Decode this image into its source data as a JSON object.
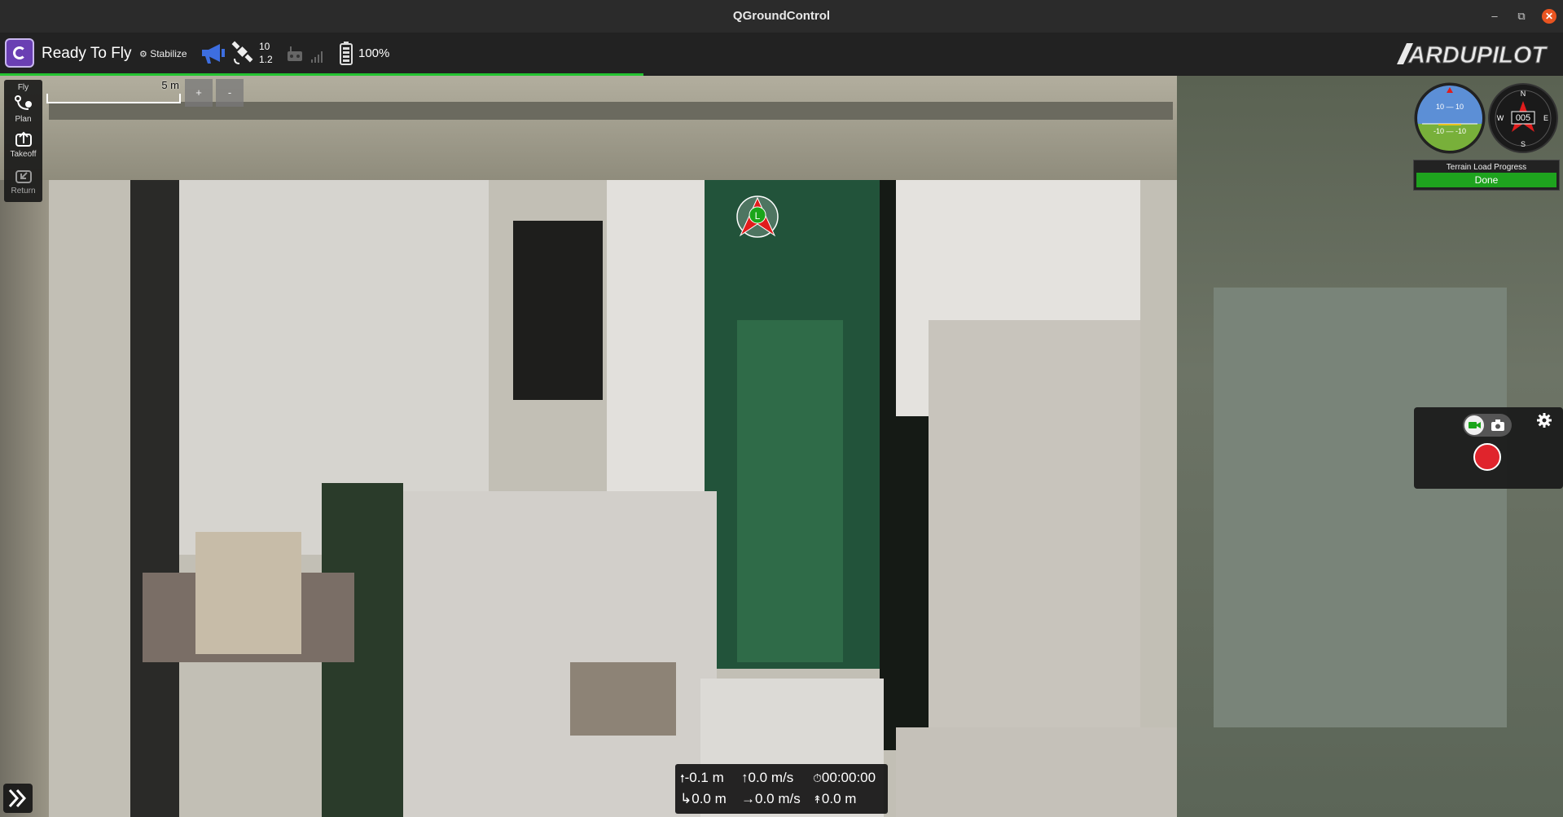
{
  "window": {
    "title": "QGroundControl"
  },
  "toolbar": {
    "status": "Ready To Fly",
    "flight_mode": "Stabilize",
    "gps_satellites": "10",
    "gps_hdop": "1.2",
    "battery": "100%",
    "brand_logo": "ARDUPILOT"
  },
  "map": {
    "scale_label": "5 m",
    "zoom_in": "+",
    "zoom_out": "-",
    "vehicle_label": "L"
  },
  "fly_tools": [
    {
      "label": "Fly",
      "icon": "fly-icon"
    },
    {
      "label": "Plan",
      "icon": "plan-icon"
    },
    {
      "label": "Takeoff",
      "icon": "takeoff-icon"
    },
    {
      "label": "Return",
      "icon": "return-icon"
    }
  ],
  "instruments": {
    "attitude_top": "10 — 10",
    "attitude_bottom": "-10 — -10",
    "compass_heading": "005",
    "compass_n": "N",
    "compass_e": "E",
    "compass_s": "S",
    "compass_w": "W"
  },
  "terrain": {
    "title": "Terrain Load Progress",
    "status": "Done"
  },
  "telemetry": {
    "altitude": "-0.1 m",
    "vertical_speed": "0.0 m/s",
    "flight_time": "00:00:00",
    "distance": "0.0 m",
    "horizontal_speed": "0.0 m/s",
    "distance_to_home": "0.0 m"
  },
  "colors": {
    "progress": "#24c431",
    "done": "#1ea31e",
    "record": "#e0242c",
    "brand": "#6a3fb3"
  }
}
